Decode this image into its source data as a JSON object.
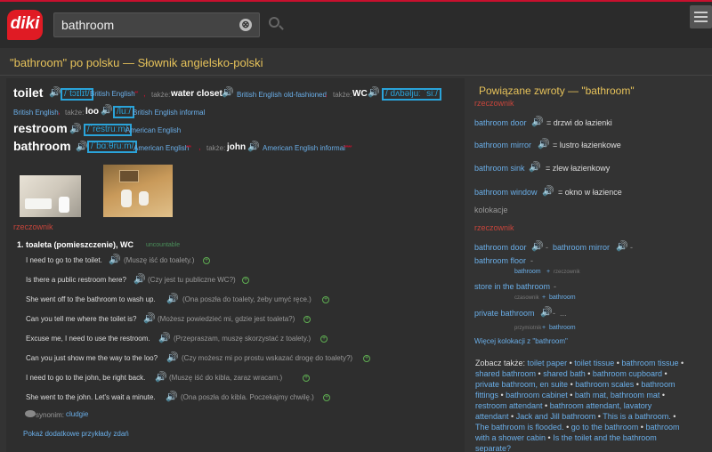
{
  "header": {
    "logo": "diki",
    "search_value": "bathroom",
    "search_placeholder": "",
    "clear_glyph": "⊗"
  },
  "page_title": "\"bathroom\" po polsku — Słownik angielsko-polski",
  "entry": {
    "toilet": "toilet",
    "toilet_ipa": "/ˈtɔɪlɪt/",
    "british_english": "British English",
    "takze": "także:",
    "water_closet": "water closet",
    "british_english_old": "British English old-fashioned",
    "wc": "WC",
    "wc_ipa": "/ dʌbəljuː ˈsiː/",
    "loo": "loo",
    "loo_ipa": "/luː/",
    "british_english_informal": "British English informal",
    "restroom": "restroom",
    "restroom_ipa": "/ˈrestruːm/",
    "american_english": "American English",
    "bathroom": "bathroom",
    "bathroom_ipa": "/ˈbɑːθruːm/",
    "american_english_2": "American English",
    "john": "john",
    "american_english_informal": "American English informal",
    "stars": "*****",
    "stars_small": "***",
    "pos": "rzeczownik"
  },
  "meaning": {
    "number": "1.",
    "text": "toaleta (pomieszczenie), WC",
    "tag": "uncountable"
  },
  "examples": [
    {
      "en": "I need to go to the toilet.",
      "pl": "(Muszę iść do toalety.)"
    },
    {
      "en": "Is there a public restroom here?",
      "pl": "(Czy jest tu publiczne WC?)"
    },
    {
      "en": "She went off to the bathroom to wash up.",
      "pl": "(Ona poszła do toalety, żeby umyć ręce.)"
    },
    {
      "en": "Can you tell me where the toilet is?",
      "pl": "(Możesz powiedzieć mi, gdzie jest toaleta?)"
    },
    {
      "en": "Excuse me, I need to use the restroom.",
      "pl": "(Przepraszam, muszę skorzystać z toalety.)"
    },
    {
      "en": "Can you just show me the way to the loo?",
      "pl": "(Czy możesz mi po prostu wskazać drogę do toalety?)"
    },
    {
      "en": "I need to go to the john, be right back.",
      "pl": "(Muszę iść do kibla, zaraz wracam.)"
    },
    {
      "en": "She went to the john. Let's wait a minute.",
      "pl": "(Ona poszła do kibla. Poczekajmy chwilę.)"
    }
  ],
  "synonym_label": "synonim:",
  "synonym_value": "cludgie",
  "more_examples": "Pokaż dodatkowe przykłady zdań",
  "related": {
    "title": "Powiązane zwroty — \"bathroom\"",
    "pos": "rzeczownik",
    "items": [
      {
        "en": "bathroom door",
        "pl": "= drzwi do łazienki"
      },
      {
        "en": "bathroom mirror",
        "pl": "= lustro łazienkowe"
      },
      {
        "en": "bathroom sink",
        "pl": "= zlew łazienkowy"
      },
      {
        "en": "bathroom window",
        "pl": "= okno w łazience"
      }
    ],
    "kolokacje": "kolokacje",
    "pos2": "rzeczownik",
    "col1": "bathroom door",
    "col2": "bathroom mirror",
    "col3": "bathroom floor",
    "col3_sub_a": "bathroom",
    "col3_sub_b": "rzeczownik",
    "col4": "store in the bathroom",
    "col4_sub_a": "czasownik",
    "col4_sub_b": "bathroom",
    "col5": "private bathroom",
    "col5_sub_a": "przymiotnik",
    "col5_sub_b": "bathroom",
    "more_col": "Więcej kolokacji z \"bathroom\"",
    "dash": "-",
    "plus": "+",
    "ellipsis": "..."
  },
  "see_also": {
    "label": "Zobacz także:",
    "links": [
      "toilet paper",
      "toilet tissue",
      "bathroom tissue",
      "shared bathroom",
      "shared bath",
      "bathroom cupboard",
      "private bathroom, en suite",
      "bathroom scales",
      "bathroom fittings",
      "bathroom cabinet",
      "bath mat, bathroom mat",
      "restroom attendant",
      "bathroom attendant, lavatory attendant",
      "Jack and Jill bathroom",
      "This is a bathroom.",
      "The bathroom is flooded.",
      "go to the bathroom",
      "bathroom with a shower cabin",
      "Is the toilet and the bathroom separate?"
    ]
  },
  "colors": {
    "accent": "#c8102e",
    "link": "#6aaee8",
    "title": "#e6c25a"
  }
}
